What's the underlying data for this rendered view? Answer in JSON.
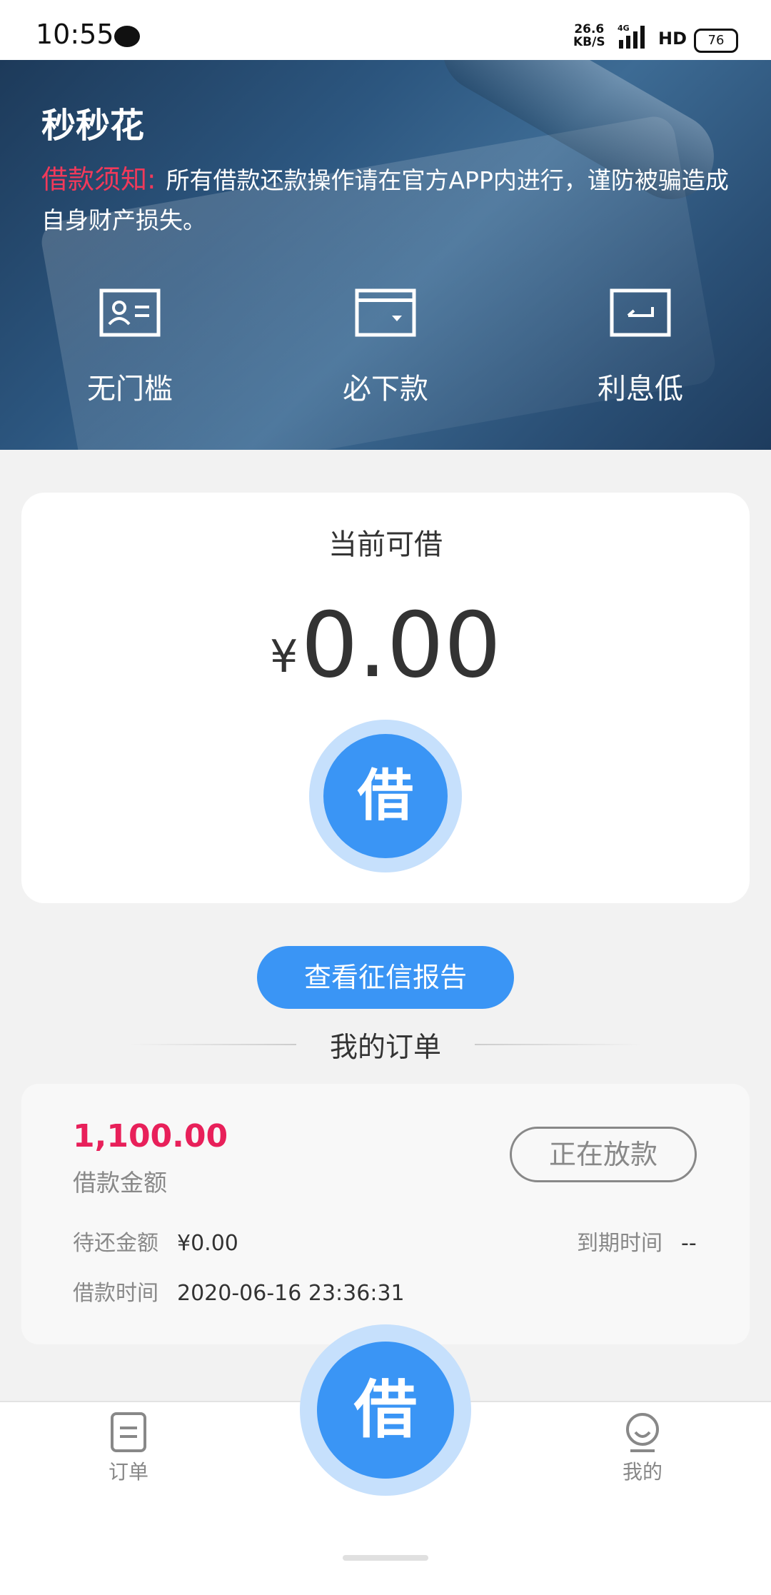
{
  "status_bar": {
    "time": "10:55",
    "net_speed_value": "26.6",
    "net_speed_unit": "KB/S",
    "network": "4G",
    "hd": "HD",
    "battery": "76"
  },
  "banner": {
    "app_title": "秒秒花",
    "notice_label": "借款须知:",
    "notice_text": "所有借款还款操作请在官方APP内进行，谨防被骗造成自身财产损失。",
    "features": [
      {
        "label": "无门槛",
        "icon": "id-card-icon"
      },
      {
        "label": "必下款",
        "icon": "wallet-icon"
      },
      {
        "label": "利息低",
        "icon": "return-icon"
      }
    ]
  },
  "borrow_card": {
    "title": "当前可借",
    "currency": "¥",
    "amount": "0.00",
    "button_label": "借"
  },
  "credit_report_button": "查看征信报告",
  "orders": {
    "heading": "我的订单",
    "items": [
      {
        "amount": "1,100.00",
        "amount_label": "借款金额",
        "status": "正在放款",
        "pending_label": "待还金额",
        "pending_value": "¥0.00",
        "due_label": "到期时间",
        "due_value": "--",
        "time_label": "借款时间",
        "time_value": "2020-06-16 23:36:31"
      }
    ]
  },
  "tabbar": {
    "left_label": "订单",
    "center_label": "借",
    "right_label": "我的"
  },
  "colors": {
    "accent_blue": "#3a95f5",
    "accent_light_blue": "#c6e0fc",
    "highlight_red": "#e8205a",
    "notice_red": "#f1395a"
  }
}
